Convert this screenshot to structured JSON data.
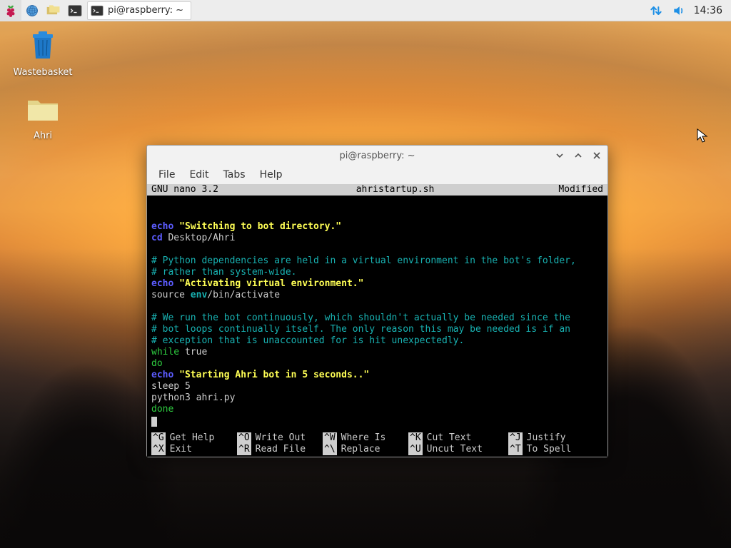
{
  "taskbar": {
    "task_button_label": "pi@raspberry: ~",
    "clock": "14:36"
  },
  "desktop": {
    "icons": [
      {
        "label": "Wastebasket"
      },
      {
        "label": "Ahri"
      }
    ]
  },
  "window": {
    "title": "pi@raspberry: ~",
    "menu": {
      "file": "File",
      "edit": "Edit",
      "tabs": "Tabs",
      "help": "Help"
    }
  },
  "nano": {
    "header_left": "  GNU nano 3.2",
    "header_center": "ahristartup.sh",
    "header_right": "Modified ",
    "lines": {
      "l1_kw": "echo",
      "l1_str": " \"Switching to bot directory.\"",
      "l2_kw": "cd",
      "l2_rest": " Desktop/Ahri",
      "blank": "",
      "c1": "# Python dependencies are held in a virtual environment in the bot's folder,",
      "c2": "# rather than system-wide.",
      "l3_kw": "echo",
      "l3_str": " \"Activating virtual environment.\"",
      "l4a": "source ",
      "l4b": "env",
      "l4c": "/bin/activate",
      "c3": "# We run the bot continuously, which shouldn't actually be needed since the",
      "c4": "# bot loops continually itself. The only reason this may be needed is if an",
      "c5": "# exception that is unaccounted for is hit unexpectedly.",
      "l5a": "while",
      "l5b": " true",
      "l6": "do",
      "l7_kw": "echo",
      "l7_str": " \"Starting Ahri bot in 5 seconds..\"",
      "l8": "sleep 5",
      "l9": "python3 ahri.py",
      "l10": "done"
    },
    "footer": {
      "r1": [
        {
          "k": "^G",
          "t": "Get Help"
        },
        {
          "k": "^O",
          "t": "Write Out"
        },
        {
          "k": "^W",
          "t": "Where Is"
        },
        {
          "k": "^K",
          "t": "Cut Text"
        },
        {
          "k": "^J",
          "t": "Justify"
        }
      ],
      "r2": [
        {
          "k": "^X",
          "t": "Exit"
        },
        {
          "k": "^R",
          "t": "Read File"
        },
        {
          "k": "^\\",
          "t": "Replace"
        },
        {
          "k": "^U",
          "t": "Uncut Text"
        },
        {
          "k": "^T",
          "t": "To Spell"
        }
      ]
    }
  }
}
